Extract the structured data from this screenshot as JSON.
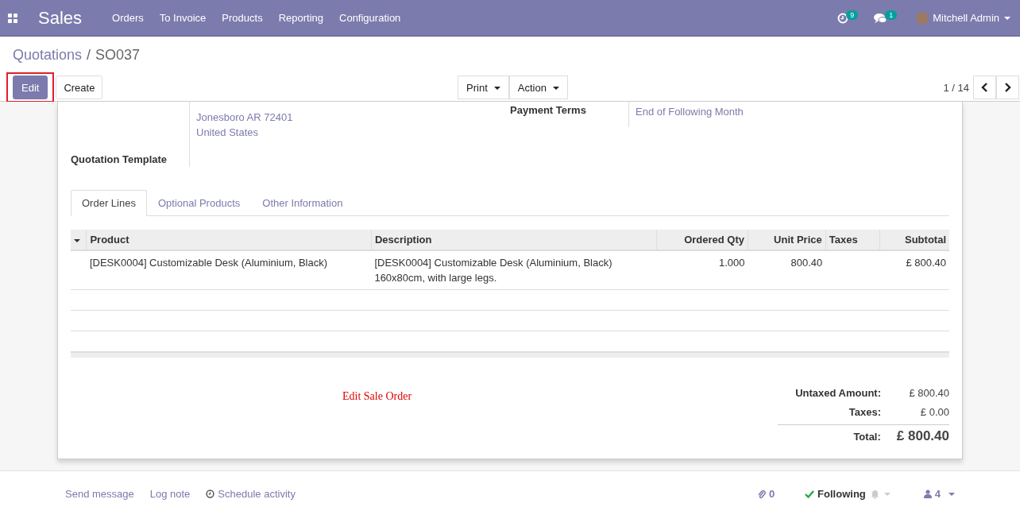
{
  "navbar": {
    "app_name": "Sales",
    "menu": [
      "Orders",
      "To Invoice",
      "Products",
      "Reporting",
      "Configuration"
    ],
    "activity_count": "9",
    "message_count": "1",
    "user": "Mitchell Admin"
  },
  "breadcrumb": {
    "parent": "Quotations",
    "separator": "/",
    "current": "SO037"
  },
  "buttons": [
    {
      "label": "Edit",
      "kind": "primary",
      "highlighted": true
    },
    {
      "label": "Create",
      "kind": "secondary",
      "highlighted": false
    }
  ],
  "dropdowns": [
    "Print",
    "Action"
  ],
  "pager": "1 / 14",
  "form": {
    "address_lines": [
      "Jonesboro AR 72401",
      "United States"
    ],
    "quotation_template_label": "Quotation Template",
    "payment_terms_label": "Payment Terms",
    "payment_terms_value": "End of Following Month"
  },
  "tabs": [
    {
      "label": "Order Lines",
      "selected": true
    },
    {
      "label": "Optional Products",
      "selected": false
    },
    {
      "label": "Other Information",
      "selected": false
    }
  ],
  "table": {
    "columns": [
      "Product",
      "Description",
      "Ordered Qty",
      "Unit Price",
      "Taxes",
      "Subtotal"
    ],
    "rows": [
      [
        "[DESK0004] Customizable Desk (Aluminium, Black)",
        "[DESK0004] Customizable Desk (Aluminium, Black)\n160x80cm, with large legs.",
        "1.000",
        "800.40",
        "",
        "£ 800.40"
      ]
    ]
  },
  "annotation": "Edit Sale Order",
  "totals": [
    {
      "label": "Untaxed Amount:",
      "value": "£ 800.40",
      "kind": "line"
    },
    {
      "label": "Taxes:",
      "value": "£ 0.00",
      "kind": "line"
    },
    {
      "label": "Total:",
      "value": "£ 800.40",
      "kind": "total"
    }
  ],
  "chatter": {
    "actions": [
      {
        "label": "Send message",
        "kind": "plain"
      },
      {
        "label": "Log note",
        "kind": "plain"
      },
      {
        "label": "Schedule activity",
        "kind": "activity"
      }
    ],
    "attachments": "0",
    "follow": "Following",
    "followers": "4"
  }
}
